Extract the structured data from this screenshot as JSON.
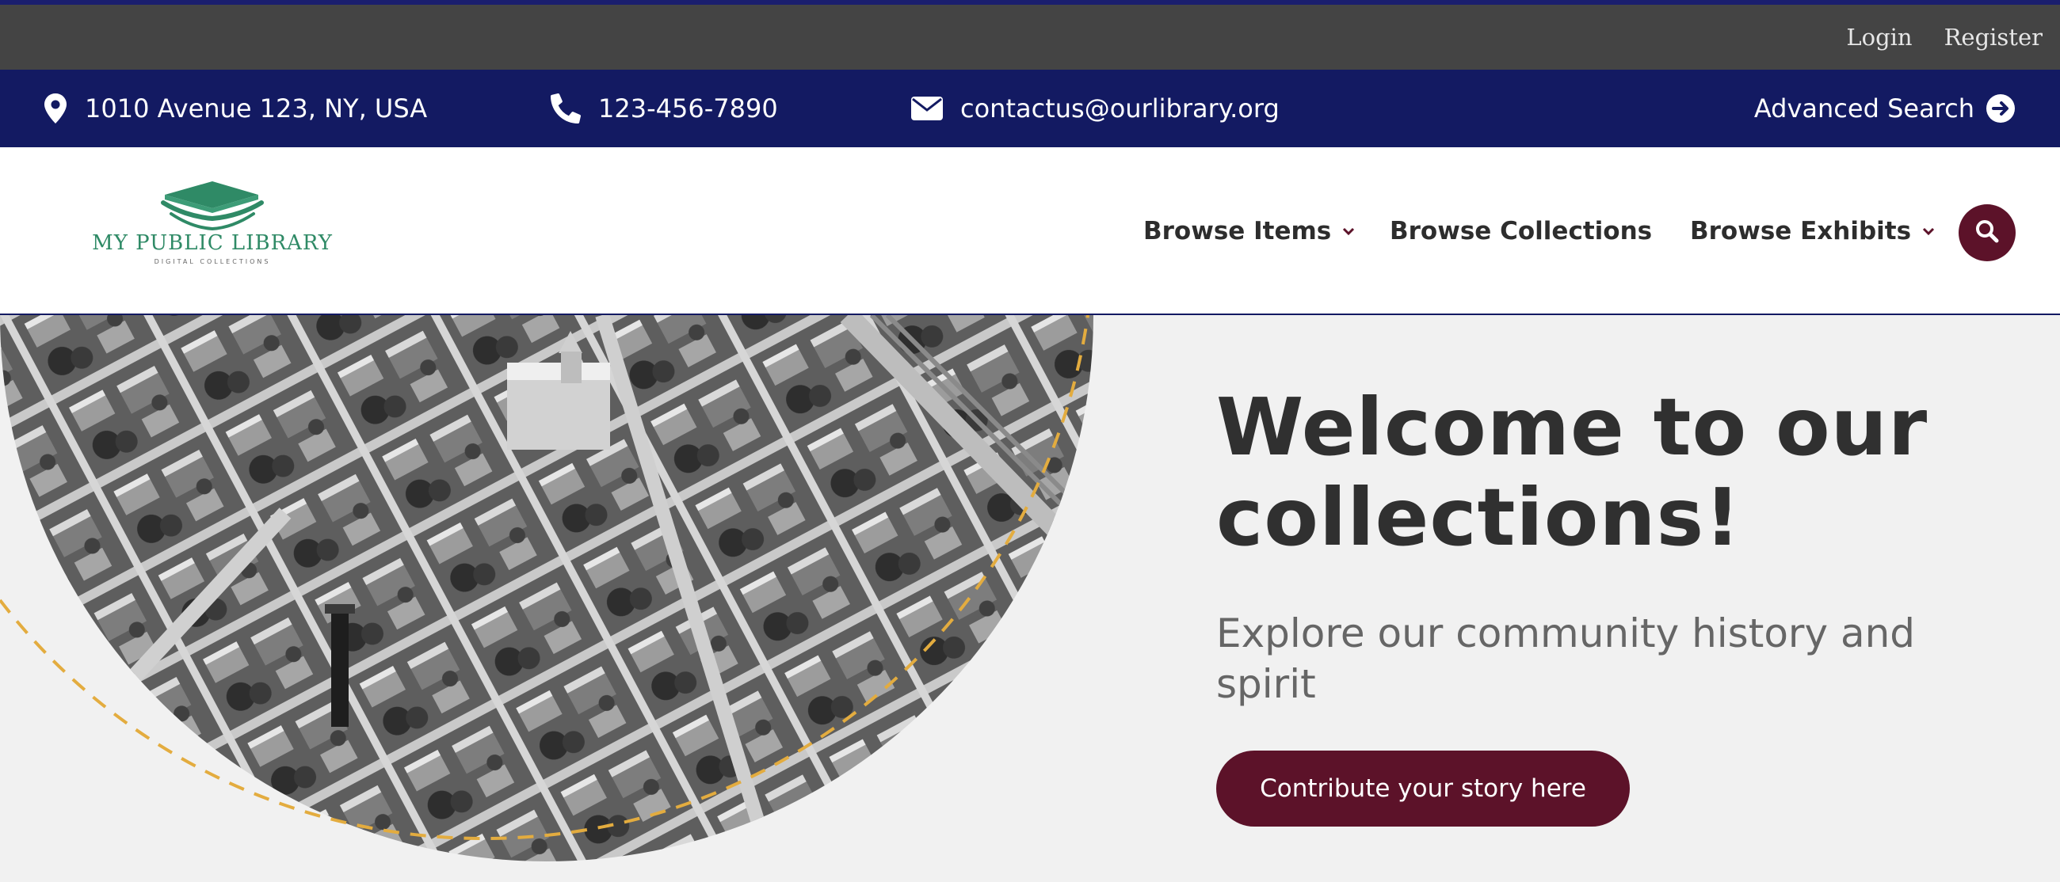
{
  "account": {
    "login_label": "Login",
    "register_label": "Register"
  },
  "contact": {
    "address": "1010 Avenue 123, NY, USA",
    "phone": "123-456-7890",
    "email": "contactus@ourlibrary.org",
    "advanced_search_label": "Advanced Search"
  },
  "logo": {
    "title": "MY PUBLIC LIBRARY",
    "subtitle": "DIGITAL COLLECTIONS"
  },
  "nav": {
    "browse_items": "Browse Items",
    "browse_collections": "Browse Collections",
    "browse_exhibits": "Browse Exhibits"
  },
  "hero": {
    "title": "Welcome to our collections!",
    "subtitle": "Explore our community history and spirit",
    "cta_label": "Contribute your story here"
  },
  "icons": {
    "address": "map-pin-icon",
    "phone": "phone-icon",
    "email": "envelope-icon",
    "advanced_search": "arrow-circle-right-icon",
    "dropdown": "chevron-down-icon",
    "search": "magnifier-icon",
    "logo": "open-book-icon"
  },
  "colors": {
    "top_bar": "#444444",
    "info_bar": "#131a62",
    "accent": "#5c1229",
    "logo_green": "#2f8a66",
    "hero_bg": "#f1f1f1",
    "dashed_arc": "#e3ac3f"
  }
}
